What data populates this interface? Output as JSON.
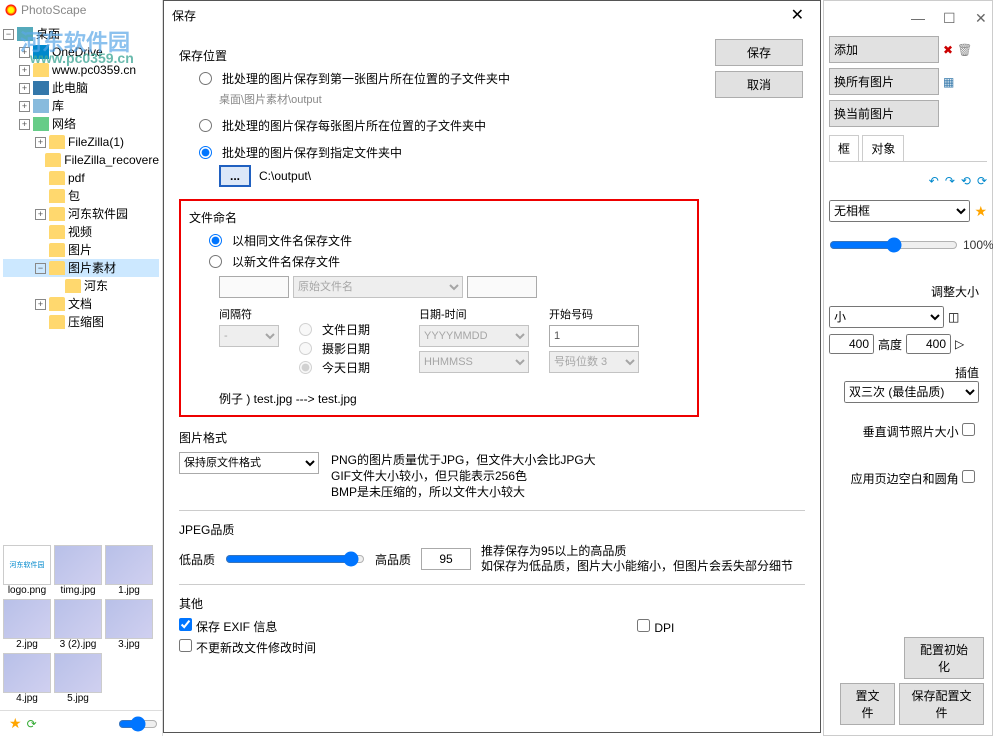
{
  "app": {
    "name": "PhotoScape",
    "watermark": "河东软件园",
    "watermark_url": "www.pc0359.cn"
  },
  "main_window": {
    "add_btn": "添加",
    "replace_all": "换所有图片",
    "replace_current": "换当前图片",
    "tab_frame": "框",
    "tab_object": "对象",
    "frame_option": "无相框",
    "zoom_percent": "100%",
    "resize_label": "调整大小",
    "size_option": "小",
    "width": "400",
    "height_label": "高度",
    "height": "400",
    "interp_label": "插值",
    "interp_option": "双三次 (最佳品质)",
    "aspect_label": "垂直调节照片大小",
    "margin_label": "应用页边空白和圆角",
    "config_init": "配置初始化",
    "config_file": "置文件",
    "save_config": "保存配置文件"
  },
  "tree": {
    "root": "桌面",
    "items": [
      {
        "label": "OneDrive",
        "icon": "cloud"
      },
      {
        "label": "www.pc0359.cn",
        "icon": "folder"
      },
      {
        "label": "此电脑",
        "icon": "pc"
      },
      {
        "label": "库",
        "icon": "lib"
      },
      {
        "label": "网络",
        "icon": "net"
      },
      {
        "label": "FileZilla(1)",
        "icon": "folder"
      },
      {
        "label": "FileZilla_recovere",
        "icon": "folder"
      },
      {
        "label": "pdf",
        "icon": "folder"
      },
      {
        "label": "包",
        "icon": "folder"
      },
      {
        "label": "河东软件园",
        "icon": "folder"
      },
      {
        "label": "视频",
        "icon": "folder"
      },
      {
        "label": "图片",
        "icon": "folder"
      },
      {
        "label": "图片素材",
        "icon": "folder",
        "expanded": true,
        "selected": true
      },
      {
        "label": "河东",
        "icon": "folder",
        "indent": 3
      },
      {
        "label": "文档",
        "icon": "folder"
      },
      {
        "label": "压缩图",
        "icon": "folder"
      }
    ]
  },
  "thumbnails": [
    {
      "label": "logo.png"
    },
    {
      "label": "timg.jpg"
    },
    {
      "label": "1.jpg"
    },
    {
      "label": "2.jpg"
    },
    {
      "label": "3 (2).jpg"
    },
    {
      "label": "3.jpg"
    },
    {
      "label": "4.jpg"
    },
    {
      "label": "5.jpg"
    }
  ],
  "dialog": {
    "title": "保存",
    "save_btn": "保存",
    "cancel_btn": "取消",
    "save_location_label": "保存位置",
    "loc_opt1": "批处理的图片保存到第一张图片所在位置的子文件夹中",
    "loc_opt1_path": "桌面\\图片素材\\output",
    "loc_opt2": "批处理的图片保存每张图片所在位置的子文件夹中",
    "loc_opt3": "批处理的图片保存到指定文件夹中",
    "loc_opt3_path": "C:\\output\\",
    "browse": "...",
    "filename_label": "文件命名",
    "name_opt1": "以相同文件名保存文件",
    "name_opt2": "以新文件名保存文件",
    "orig_name": "原始文件名",
    "sep_label": "间隔符",
    "sep_value": "-",
    "date_label": "日期-时间",
    "date_fmt": "YYYYMMDD",
    "time_fmt": "HHMMSS",
    "date_opt1": "文件日期",
    "date_opt2": "摄影日期",
    "date_opt3": "今天日期",
    "start_num_label": "开始号码",
    "start_num": "1",
    "digits": "号码位数 3",
    "example_label": "例子 ) test.jpg ---> test.jpg",
    "format_label": "图片格式",
    "format_option": "保持原文件格式",
    "format_desc1": "PNG的图片质量优于JPG，但文件大小会比JPG大",
    "format_desc2": "GIF文件大小较小，但只能表示256色",
    "format_desc3": "BMP是未压缩的，所以文件大小较大",
    "jpeg_label": "JPEG品质",
    "low_q": "低品质",
    "high_q": "高品质",
    "jpeg_value": "95",
    "jpeg_desc1": "推荐保存为95以上的高品质",
    "jpeg_desc2": "如保存为低品质，图片大小能缩小，但图片会丢失部分细节",
    "other_label": "其他",
    "save_exif": "保存 EXIF 信息",
    "dpi": "DPI",
    "no_update_time": "不更新改文件修改时间"
  }
}
